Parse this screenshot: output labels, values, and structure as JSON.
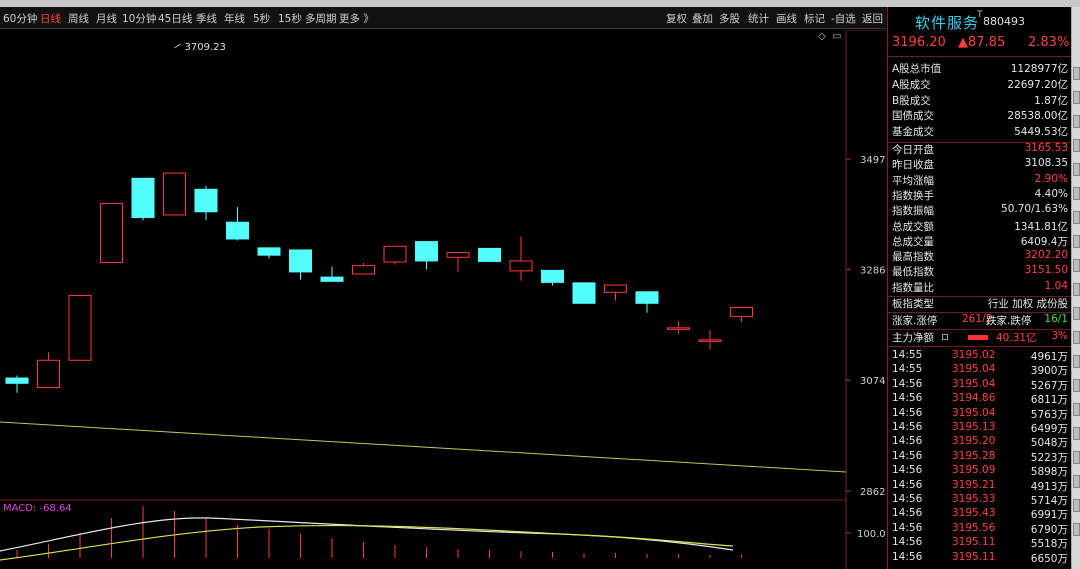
{
  "toolbar": {
    "left_items": [
      {
        "label": "60分钟",
        "active": false
      },
      {
        "label": "日线",
        "active": true
      },
      {
        "label": "周线",
        "active": false
      },
      {
        "label": "月线",
        "active": false
      },
      {
        "label": "10分钟",
        "active": false
      },
      {
        "label": "45日线",
        "active": false
      },
      {
        "label": "季线",
        "active": false
      },
      {
        "label": "年线",
        "active": false
      },
      {
        "label": "5秒",
        "active": false
      },
      {
        "label": "15秒",
        "active": false
      },
      {
        "label": "多周期",
        "active": false
      },
      {
        "label": "更多 》",
        "active": false
      }
    ],
    "right_items": [
      "复权",
      "叠加",
      "多股",
      "统计",
      "画线",
      "标记",
      "-自选",
      "返回"
    ]
  },
  "chart_data": {
    "type": "candlestick",
    "y_ticks": [
      3497,
      3286,
      3074,
      2862
    ],
    "ylim": [
      2862,
      3709.23
    ],
    "high_annotation": "3709.23",
    "up_color": "#ff3b3b",
    "down_color": "#54ffff",
    "candles": [
      {
        "open": 3078,
        "close": 3068,
        "high": 3083,
        "low": 3050
      },
      {
        "open": 3060,
        "close": 3112,
        "high": 3127,
        "low": 3060
      },
      {
        "open": 3112,
        "close": 3236,
        "high": 3236,
        "low": 3112
      },
      {
        "open": 3299,
        "close": 3412,
        "high": 3412,
        "low": 3299
      },
      {
        "open": 3460,
        "close": 3385,
        "high": 3460,
        "low": 3379
      },
      {
        "open": 3390,
        "close": 3470,
        "high": 3470,
        "low": 3390
      },
      {
        "open": 3439,
        "close": 3396,
        "high": 3446,
        "low": 3380
      },
      {
        "open": 3376,
        "close": 3344,
        "high": 3405,
        "low": 3341
      },
      {
        "open": 3327,
        "close": 3313,
        "high": 3327,
        "low": 3307
      },
      {
        "open": 3323,
        "close": 3281,
        "high": 3323,
        "low": 3266
      },
      {
        "open": 3271,
        "close": 3263,
        "high": 3291,
        "low": 3263
      },
      {
        "open": 3277,
        "close": 3293,
        "high": 3298,
        "low": 3277
      },
      {
        "open": 3300,
        "close": 3330,
        "high": 3330,
        "low": 3295
      },
      {
        "open": 3339,
        "close": 3302,
        "high": 3339,
        "low": 3286
      },
      {
        "open": 3309,
        "close": 3318,
        "high": 3318,
        "low": 3281
      },
      {
        "open": 3326,
        "close": 3301,
        "high": 3326,
        "low": 3301
      },
      {
        "open": 3283,
        "close": 3302,
        "high": 3348,
        "low": 3264
      },
      {
        "open": 3284,
        "close": 3261,
        "high": 3284,
        "low": 3255
      },
      {
        "open": 3260,
        "close": 3221,
        "high": 3260,
        "low": 3221
      },
      {
        "open": 3242,
        "close": 3256,
        "high": 3256,
        "low": 3226
      },
      {
        "open": 3243,
        "close": 3221,
        "high": 3243,
        "low": 3203
      },
      {
        "open": 3172,
        "close": 3174,
        "high": 3186,
        "low": 3162
      },
      {
        "open": 3149,
        "close": 3151,
        "high": 3170,
        "low": 3133
      },
      {
        "open": 3196,
        "close": 3213,
        "high": 3213,
        "low": 3186
      }
    ]
  },
  "macd": {
    "label": "MACD: -68.64",
    "level_label": "100.0",
    "bar_values": [
      8,
      14,
      25,
      40,
      52,
      47,
      40,
      33,
      29,
      24,
      20,
      16,
      13,
      11,
      9,
      8,
      7,
      6,
      5,
      5,
      4,
      4,
      3,
      3
    ]
  },
  "side": {
    "title": "软件服务",
    "title_sup": "T",
    "code": "880493",
    "price": "3196.20",
    "change": "▲87.85",
    "change_pct": "2.83%",
    "stats": [
      {
        "k": "A股总市值",
        "v": "1128977亿",
        "c": ""
      },
      {
        "k": "A股成交",
        "v": "22697.20亿",
        "c": ""
      },
      {
        "k": "B股成交",
        "v": "1.87亿",
        "c": ""
      },
      {
        "k": "国债成交",
        "v": "28538.00亿",
        "c": ""
      },
      {
        "k": "基金成交",
        "v": "5449.53亿",
        "c": ""
      }
    ],
    "stats2": [
      {
        "k": "今日开盘",
        "v": "3165.53",
        "c": "red"
      },
      {
        "k": "昨日收盘",
        "v": "3108.35",
        "c": ""
      },
      {
        "k": "平均涨幅",
        "v": "2.90%",
        "c": "red"
      },
      {
        "k": "指数换手",
        "v": "4.40%",
        "c": ""
      },
      {
        "k": "指数振幅",
        "v": "50.70/1.63%",
        "c": ""
      },
      {
        "k": "总成交额",
        "v": "1341.81亿",
        "c": ""
      },
      {
        "k": "总成交量",
        "v": "6409.4万",
        "c": ""
      },
      {
        "k": "最高指数",
        "v": "3202.20",
        "c": "red"
      },
      {
        "k": "最低指数",
        "v": "3151.50",
        "c": "red"
      },
      {
        "k": "指数量比",
        "v": "1.04",
        "c": "red"
      }
    ],
    "type_label": "板指类型",
    "type_value": "行业 加权 成份股",
    "updown_label": "涨家.涨停",
    "updown_value": "261/2",
    "down_label": "跌家.跌停",
    "down_value": "16/1",
    "main_flow_label": "主力净额",
    "main_flow_value": "40.31亿",
    "main_flow_pct": "3%",
    "ticks": [
      {
        "t": "14:55",
        "p": "3195.02",
        "q": "4961万"
      },
      {
        "t": "14:55",
        "p": "3195.04",
        "q": "3900万"
      },
      {
        "t": "14:56",
        "p": "3195.04",
        "q": "5267万"
      },
      {
        "t": "14:56",
        "p": "3194.86",
        "q": "6811万"
      },
      {
        "t": "14:56",
        "p": "3195.04",
        "q": "5763万"
      },
      {
        "t": "14:56",
        "p": "3195.13",
        "q": "6499万"
      },
      {
        "t": "14:56",
        "p": "3195.20",
        "q": "5048万"
      },
      {
        "t": "14:56",
        "p": "3195.28",
        "q": "5223万"
      },
      {
        "t": "14:56",
        "p": "3195.09",
        "q": "5898万"
      },
      {
        "t": "14:56",
        "p": "3195.21",
        "q": "4913万"
      },
      {
        "t": "14:56",
        "p": "3195.33",
        "q": "5714万"
      },
      {
        "t": "14:56",
        "p": "3195.43",
        "q": "6991万"
      },
      {
        "t": "14:56",
        "p": "3195.56",
        "q": "6790万"
      },
      {
        "t": "14:56",
        "p": "3195.11",
        "q": "5518万"
      },
      {
        "t": "14:56",
        "p": "3195.11",
        "q": "6650万"
      }
    ]
  }
}
